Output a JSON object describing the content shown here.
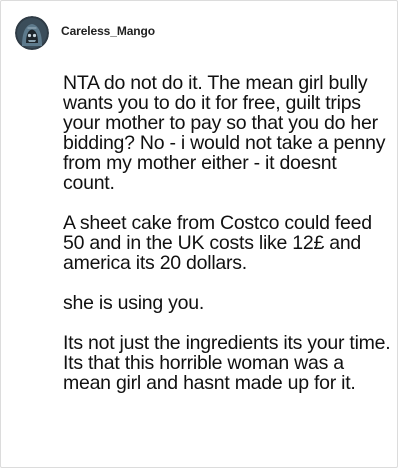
{
  "post": {
    "username": "Careless_Mango",
    "avatar_icon": "hooded-character-avatar-icon",
    "paragraphs": [
      "NTA do not do it. The mean girl bully wants you to do it for free, guilt trips your mother to pay so that you do her bidding? No - i would not take a penny from my mother either - it doesnt count.",
      "A sheet cake from Costco could feed 50 and in the UK costs like 12£ and america its 20 dollars.",
      "she is using you.",
      "Its not just the ingredients its your time. Its that this horrible woman was a mean girl and hasnt made up for it."
    ]
  },
  "colors": {
    "text": "#111111",
    "border": "#dcdcdc",
    "avatar_background": "#2f3b45",
    "avatar_hood": "#5d7a8c"
  }
}
